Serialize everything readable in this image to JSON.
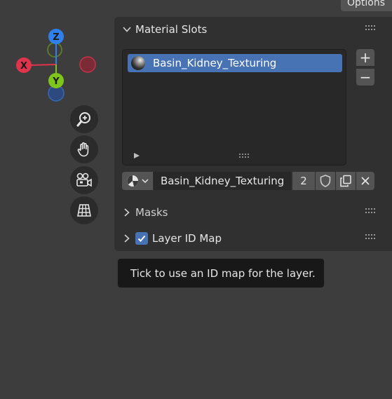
{
  "header": {
    "options_label": "Options"
  },
  "gizmo": {
    "axes": [
      {
        "label": "Z",
        "color": "#2f80ed"
      },
      {
        "label": "X",
        "color": "#e0344c"
      },
      {
        "label": "Y",
        "color": "#7ec51c"
      }
    ]
  },
  "nav_tools": [
    {
      "name": "zoom-icon"
    },
    {
      "name": "pan-hand-icon"
    },
    {
      "name": "camera-icon"
    },
    {
      "name": "orthographic-grid-icon"
    }
  ],
  "material_slots": {
    "title": "Material Slots",
    "items": [
      {
        "label": "Basin_Kidney_Texturing",
        "selected": true
      }
    ],
    "add_label": "+",
    "remove_label": "−"
  },
  "material_selector": {
    "name": "Basin_Kidney_Texturing",
    "users": "2"
  },
  "masks": {
    "title": "Masks",
    "expanded": false
  },
  "layer_id_map": {
    "title": "Layer ID Map",
    "checked": true,
    "expanded": false
  },
  "tooltip": {
    "text": "Tick to use an ID map for the layer."
  },
  "colors": {
    "accent": "#4772b3",
    "panel": "#303030",
    "background": "#3d3d3d"
  }
}
